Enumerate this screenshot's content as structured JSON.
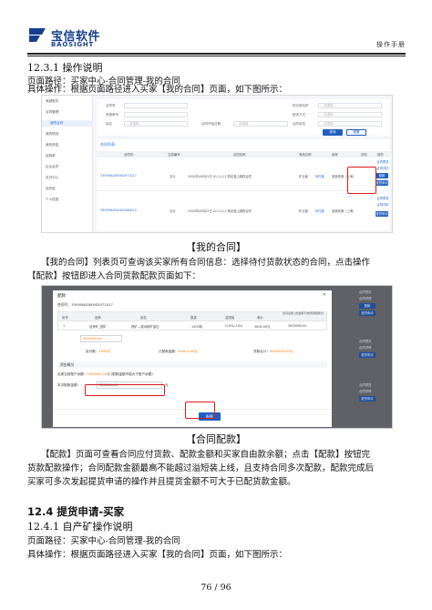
{
  "header": {
    "logo_cn": "宝信软件",
    "logo_en": "BAOSIGHT",
    "doc_tag": "操作手册"
  },
  "section1": {
    "heading": "12.3.1 操作说明",
    "path": "页面路径：买家中心-合同管理-我的合同",
    "steps": "具体操作：根据页面路径进入买家【我的合同】页面，如下图所示："
  },
  "shot1": {
    "sidebar": [
      "商城首页",
      "合同管理",
      "我的合同",
      "我的物流",
      "我的资金",
      "结算单",
      "企业会员",
      "支付中心",
      "站内信",
      "个人信息"
    ],
    "filter_labels": [
      "合同号",
      "资源单号",
      "品名",
      "合同开始日期",
      "供应商名称",
      "配送方式",
      "合同状态"
    ],
    "filter_placeholder": "—请选择—",
    "search_btn": "查询",
    "reset_btn": "重置",
    "table_title": "合同列表",
    "columns": [
      "合同号",
      "交易编号",
      "合同名称",
      "商品名称",
      "卖家",
      "状态",
      "操作"
    ],
    "rows": [
      {
        "contract_no": "33HYMAZXKH02971017",
        "trade_no": "无污",
        "name": "2020年09月02日 01:11:11 购买宝山钢铁合同",
        "product": "矿业面",
        "seller": "宝钢资源（上海）",
        "status": "待付款"
      },
      {
        "contract_no": "33HYMAZXKH02960015",
        "trade_no": "无污",
        "name": "2020年09月02日 01:11:11 购买宝山钢铁合同",
        "product": "矿业面",
        "seller": "宝钢资源（上海）",
        "status": "待付款"
      }
    ],
    "op_view": "合同预览",
    "op_detail": "合同详情",
    "op_pay": "配款",
    "op_apply": "提货申请"
  },
  "caption1": "【我的合同】",
  "para1_line1": "【我的合同】列表页可查询该买家所有合同信息：选择待付货款状态的合同，点击操作",
  "para1_line2": "【配款】按钮即进入合同货款配款页面如下：",
  "shot2": {
    "title": "配款",
    "close": "✕",
    "contract_label": "合同号：",
    "contract_no": "33HYMAZXKH02971017",
    "columns": [
      "序号",
      "品种",
      "品名",
      "数量",
      "溢短装",
      "单价",
      "合同总额 (此金额不含增值税部分)"
    ],
    "row": [
      "1",
      "自贸矿_铁矿",
      "铁矿—澳洲粉矿品位",
      "1500吨",
      "+10%/-10%",
      "3000.00元",
      "3000000.00"
    ],
    "amount_input": "3000000.00",
    "sum_left_label": "实付款：",
    "sum_left_value": "1500元",
    "sum_mid_label": "已配款金额：",
    "sum_mid_value": "Yuan 0.00元",
    "sum_right_label": "货款合计：",
    "sum_right_value": "3000000.00元",
    "fund_section": "资金概况",
    "balance_label": "买家当前账户余额：",
    "balance_value": "2000000.00",
    "balance_unit": "元",
    "balance_note": "(配款金额不能大于账户余额)",
    "pay_amount_label": "本次配款金额：",
    "pay_amount_value": "3200000.00",
    "pay_amount_unit": "元",
    "pay_button": "配款",
    "right_links": [
      "合同预览",
      "合同详情",
      "配款",
      "提货申请",
      "合同预览",
      "合同详情",
      "提货申请",
      "合同预览",
      "合同详情",
      "提货申请"
    ]
  },
  "caption2": "【合同配款】",
  "para2_line1": "【配款】页面可查看合同应付货款、配款金额和买家自由款余额；点击【配款】按钮完",
  "para2_line2": "货款配款操作；合同配款金额最高不能超过溢短装上线，且支持合同多次配款，配款完成后",
  "para2_line3": "买家可多次发起提货申请的操作并且提货金额不可大于已配货款金额。",
  "section2": {
    "heading": "12.4 提货申请-买家",
    "sub_heading": "12.4.1 自产矿操作说明",
    "path": "页面路径：买家中心-合同管理-我的合同",
    "steps": "具体操作：根据页面路径进入买家【我的合同】页面，如下图所示："
  },
  "page_number": "76 / 96",
  "colors": {
    "brand": "#173f8f",
    "primary": "#1f5fbf",
    "highlight": "#e01a1a",
    "accent_orange": "#ff7b00"
  }
}
